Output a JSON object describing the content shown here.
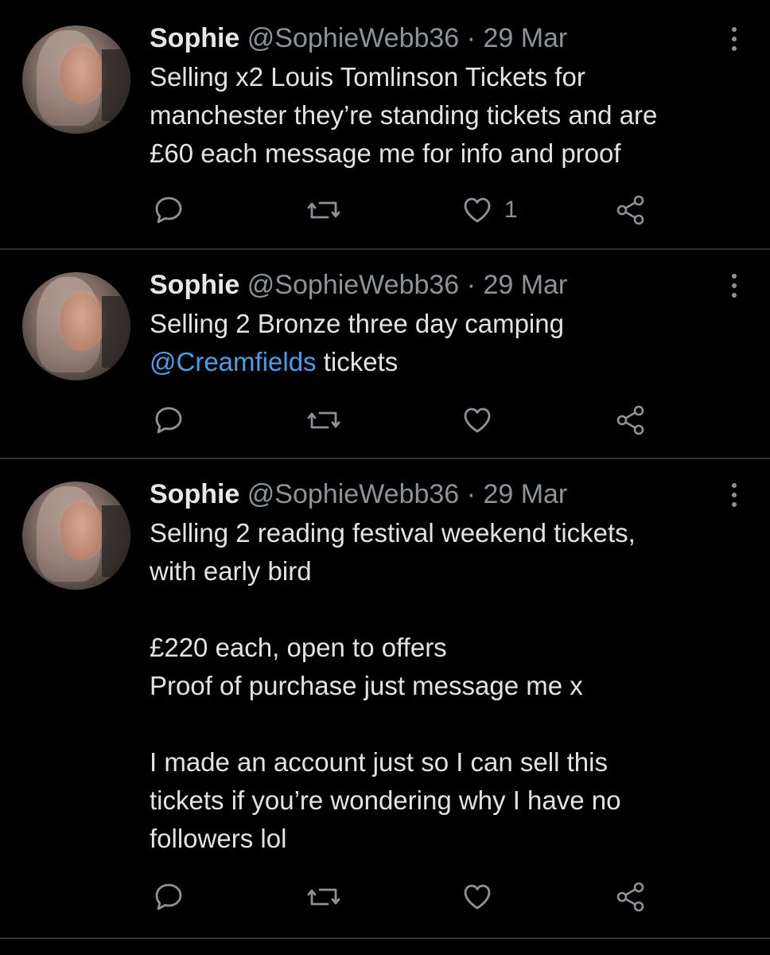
{
  "tweets": [
    {
      "name": "Sophie",
      "handle": "@SophieWebb36",
      "sep": "·",
      "date": "29 Mar",
      "text_before": "Selling x2 Louis Tomlinson Tickets for\nmanchester they’re standing tickets and are\n£60 each message me for info and proof",
      "mention": "",
      "text_after": "",
      "likes": "1"
    },
    {
      "name": "Sophie",
      "handle": "@SophieWebb36",
      "sep": "·",
      "date": "29 Mar",
      "text_before": "Selling 2 Bronze three day camping\n",
      "mention": "@Creamfields",
      "text_after": " tickets",
      "likes": ""
    },
    {
      "name": "Sophie",
      "handle": "@SophieWebb36",
      "sep": "·",
      "date": "29 Mar",
      "text_before": "Selling 2 reading festival weekend tickets,\nwith early bird\n\n£220 each, open to offers\nProof of purchase just message me x\n\nI made an account just so I can sell this\ntickets if you’re wondering why I have no\nfollowers lol",
      "mention": "",
      "text_after": "",
      "likes": ""
    }
  ],
  "icons": {
    "reply": "reply-icon",
    "retweet": "retweet-icon",
    "like": "heart-icon",
    "share": "share-icon",
    "more": "more-options-icon"
  },
  "colors": {
    "background": "#000000",
    "text": "#e3e3e3",
    "secondary": "#8b9399",
    "mention": "#4a9ee8",
    "divider": "#2f3336"
  }
}
